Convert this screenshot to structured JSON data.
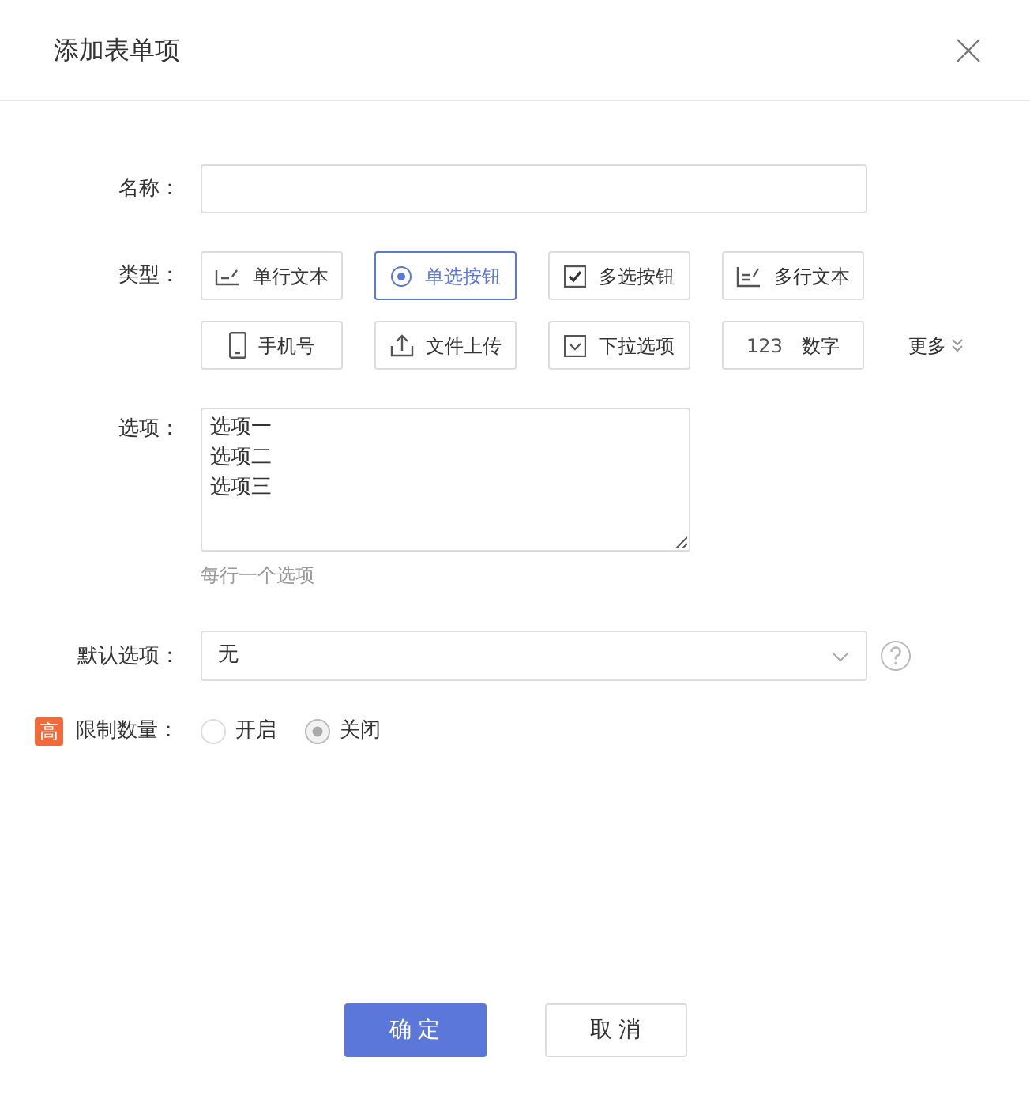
{
  "window": {
    "title": "添加表单项"
  },
  "name_field": {
    "label": "名称："
  },
  "type_field": {
    "label": "类型：",
    "more": "更多",
    "types": [
      {
        "label": "单行文本",
        "kind": "single-line",
        "selected": false
      },
      {
        "label": "单选按钮",
        "kind": "radio",
        "selected": true
      },
      {
        "label": "多选按钮",
        "kind": "checkbox",
        "selected": false
      },
      {
        "label": "多行文本",
        "kind": "multi-line",
        "selected": false
      },
      {
        "label": "手机号",
        "kind": "phone",
        "selected": false
      },
      {
        "label": "文件上传",
        "kind": "upload",
        "selected": false
      },
      {
        "label": "下拉选项",
        "kind": "dropdown",
        "selected": false
      },
      {
        "label": "数字",
        "kind": "number",
        "prefix": "123",
        "selected": false
      }
    ]
  },
  "options_field": {
    "label": "选项：",
    "lines": [
      "选项一",
      "选项二",
      "选项三"
    ],
    "hint": "每行一个选项"
  },
  "default_field": {
    "label": "默认选项：",
    "value": "无"
  },
  "limit_field": {
    "badge": "高",
    "label": "限制数量：",
    "options": [
      {
        "label": "开启",
        "selected": false
      },
      {
        "label": "关闭",
        "selected": true
      }
    ]
  },
  "buttons": [
    {
      "label": "确 定",
      "kind": "primary"
    },
    {
      "label": "取 消",
      "kind": "secondary"
    }
  ]
}
